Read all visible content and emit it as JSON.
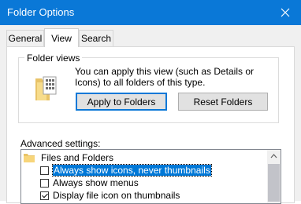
{
  "window": {
    "title": "Folder Options"
  },
  "tabs": [
    {
      "label": "General",
      "active": false
    },
    {
      "label": "View",
      "active": true
    },
    {
      "label": "Search",
      "active": false
    }
  ],
  "folder_views": {
    "group_label": "Folder views",
    "description": "You can apply this view (such as Details or Icons) to all folders of this type.",
    "apply_button": "Apply to Folders",
    "reset_button": "Reset Folders"
  },
  "advanced": {
    "label": "Advanced settings:",
    "tree": {
      "root": {
        "label": "Files and Folders",
        "icon": "folder-icon"
      },
      "items": [
        {
          "label": "Always show icons, never thumbnails",
          "checked": false,
          "selected": true
        },
        {
          "label": "Always show menus",
          "checked": false,
          "selected": false
        },
        {
          "label": "Display file icon on thumbnails",
          "checked": true,
          "selected": false
        }
      ]
    }
  },
  "colors": {
    "titlebar": "#0a78d7",
    "accent": "#0078d7",
    "dialog_bg": "#f0f0f0"
  }
}
